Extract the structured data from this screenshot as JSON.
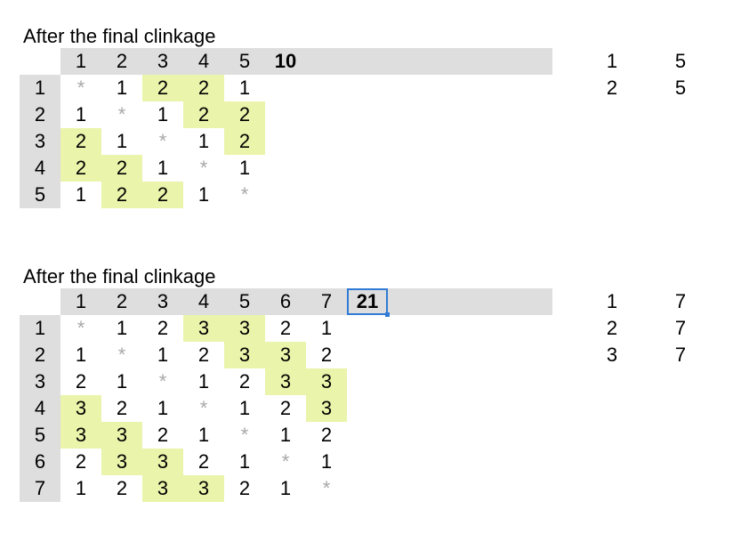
{
  "blocks": [
    {
      "title": "After the final clinkage",
      "col_headers": [
        "1",
        "2",
        "3",
        "4",
        "5"
      ],
      "total": "10",
      "row_headers": [
        "1",
        "2",
        "3",
        "4",
        "5"
      ],
      "rows": [
        [
          "*",
          "1",
          "2",
          "2",
          "1"
        ],
        [
          "1",
          "*",
          "1",
          "2",
          "2"
        ],
        [
          "2",
          "1",
          "*",
          "1",
          "2"
        ],
        [
          "2",
          "2",
          "1",
          "*",
          "1"
        ],
        [
          "1",
          "2",
          "2",
          "1",
          "*"
        ]
      ],
      "highlight": [
        [
          false,
          false,
          true,
          true,
          false
        ],
        [
          false,
          false,
          false,
          true,
          true
        ],
        [
          true,
          false,
          false,
          false,
          true
        ],
        [
          true,
          true,
          false,
          false,
          false
        ],
        [
          false,
          true,
          true,
          false,
          false
        ]
      ],
      "side": [
        [
          "1",
          "5"
        ],
        [
          "2",
          "5"
        ]
      ]
    },
    {
      "title": "After the final clinkage",
      "col_headers": [
        "1",
        "2",
        "3",
        "4",
        "5",
        "6",
        "7"
      ],
      "total": "21",
      "row_headers": [
        "1",
        "2",
        "3",
        "4",
        "5",
        "6",
        "7"
      ],
      "rows": [
        [
          "*",
          "1",
          "2",
          "3",
          "3",
          "2",
          "1"
        ],
        [
          "1",
          "*",
          "1",
          "2",
          "3",
          "3",
          "2"
        ],
        [
          "2",
          "1",
          "*",
          "1",
          "2",
          "3",
          "3"
        ],
        [
          "3",
          "2",
          "1",
          "*",
          "1",
          "2",
          "3"
        ],
        [
          "3",
          "3",
          "2",
          "1",
          "*",
          "1",
          "2"
        ],
        [
          "2",
          "3",
          "3",
          "2",
          "1",
          "*",
          "1"
        ],
        [
          "1",
          "2",
          "3",
          "3",
          "2",
          "1",
          "*"
        ]
      ],
      "highlight": [
        [
          false,
          false,
          false,
          true,
          true,
          false,
          false
        ],
        [
          false,
          false,
          false,
          false,
          true,
          true,
          false
        ],
        [
          false,
          false,
          false,
          false,
          false,
          true,
          true
        ],
        [
          true,
          false,
          false,
          false,
          false,
          false,
          true
        ],
        [
          true,
          true,
          false,
          false,
          false,
          false,
          false
        ],
        [
          false,
          true,
          true,
          false,
          false,
          false,
          false
        ],
        [
          false,
          false,
          true,
          true,
          false,
          false,
          false
        ]
      ],
      "side": [
        [
          "1",
          "7"
        ],
        [
          "2",
          "7"
        ],
        [
          "3",
          "7"
        ]
      ]
    }
  ]
}
